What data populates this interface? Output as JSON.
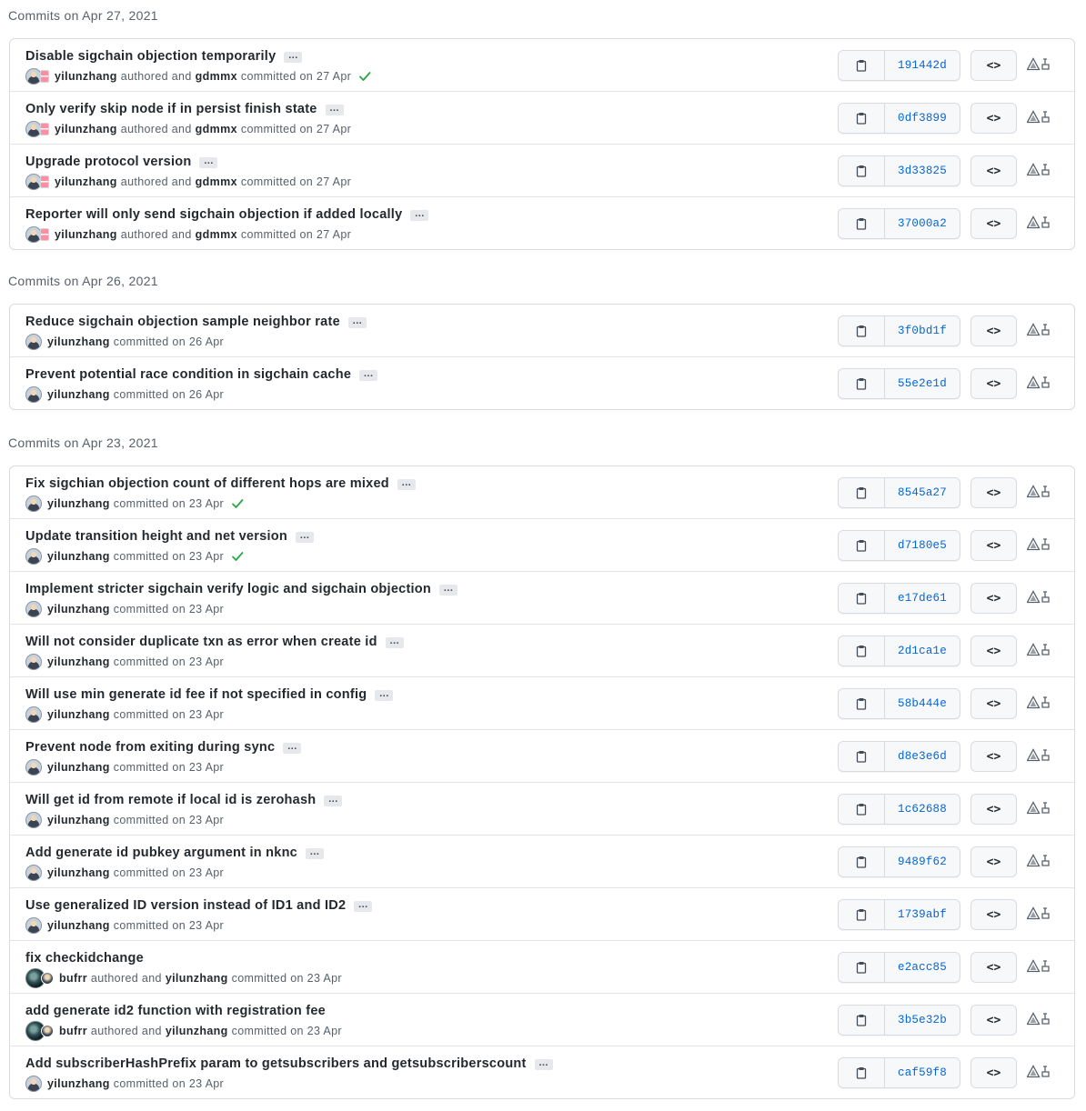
{
  "groups": [
    {
      "header": "Commits on Apr 27, 2021",
      "commits": [
        {
          "message": "Disable sigchain objection temporarily",
          "ellipsis": true,
          "avatar": "yi-gd",
          "author": "yilunzhang",
          "mid": "authored and",
          "committer": "gdmmx",
          "suffix": "committed on 27 Apr",
          "verified": true,
          "sha": "191442d"
        },
        {
          "message": "Only verify skip node if in persist finish state",
          "ellipsis": true,
          "avatar": "yi-gd",
          "author": "yilunzhang",
          "mid": "authored and",
          "committer": "gdmmx",
          "suffix": "committed on 27 Apr",
          "verified": false,
          "sha": "0df3899"
        },
        {
          "message": "Upgrade protocol version",
          "ellipsis": true,
          "avatar": "yi-gd",
          "author": "yilunzhang",
          "mid": "authored and",
          "committer": "gdmmx",
          "suffix": "committed on 27 Apr",
          "verified": false,
          "sha": "3d33825"
        },
        {
          "message": "Reporter will only send sigchain objection if added locally",
          "ellipsis": true,
          "avatar": "yi-gd",
          "author": "yilunzhang",
          "mid": "authored and",
          "committer": "gdmmx",
          "suffix": "committed on 27 Apr",
          "verified": false,
          "sha": "37000a2"
        }
      ]
    },
    {
      "header": "Commits on Apr 26, 2021",
      "commits": [
        {
          "message": "Reduce sigchain objection sample neighbor rate",
          "ellipsis": true,
          "avatar": "yi",
          "author": "yilunzhang",
          "mid": "",
          "committer": "",
          "suffix": "committed on 26 Apr",
          "verified": false,
          "sha": "3f0bd1f"
        },
        {
          "message": "Prevent potential race condition in sigchain cache",
          "ellipsis": true,
          "avatar": "yi",
          "author": "yilunzhang",
          "mid": "",
          "committer": "",
          "suffix": "committed on 26 Apr",
          "verified": false,
          "sha": "55e2e1d"
        }
      ]
    },
    {
      "header": "Commits on Apr 23, 2021",
      "commits": [
        {
          "message": "Fix sigchian objection count of different hops are mixed",
          "ellipsis": true,
          "avatar": "yi",
          "author": "yilunzhang",
          "mid": "",
          "committer": "",
          "suffix": "committed on 23 Apr",
          "verified": true,
          "sha": "8545a27"
        },
        {
          "message": "Update transition height and net version",
          "ellipsis": true,
          "avatar": "yi",
          "author": "yilunzhang",
          "mid": "",
          "committer": "",
          "suffix": "committed on 23 Apr",
          "verified": true,
          "sha": "d7180e5"
        },
        {
          "message": "Implement stricter sigchain verify logic and sigchain objection",
          "ellipsis": true,
          "avatar": "yi",
          "author": "yilunzhang",
          "mid": "",
          "committer": "",
          "suffix": "committed on 23 Apr",
          "verified": false,
          "sha": "e17de61"
        },
        {
          "message": "Will not consider duplicate txn as error when create id",
          "ellipsis": true,
          "avatar": "yi",
          "author": "yilunzhang",
          "mid": "",
          "committer": "",
          "suffix": "committed on 23 Apr",
          "verified": false,
          "sha": "2d1ca1e"
        },
        {
          "message": "Will use min generate id fee if not specified in config",
          "ellipsis": true,
          "avatar": "yi",
          "author": "yilunzhang",
          "mid": "",
          "committer": "",
          "suffix": "committed on 23 Apr",
          "verified": false,
          "sha": "58b444e"
        },
        {
          "message": "Prevent node from exiting during sync",
          "ellipsis": true,
          "avatar": "yi",
          "author": "yilunzhang",
          "mid": "",
          "committer": "",
          "suffix": "committed on 23 Apr",
          "verified": false,
          "sha": "d8e3e6d"
        },
        {
          "message": "Will get id from remote if local id is zerohash",
          "ellipsis": true,
          "avatar": "yi",
          "author": "yilunzhang",
          "mid": "",
          "committer": "",
          "suffix": "committed on 23 Apr",
          "verified": false,
          "sha": "1c62688"
        },
        {
          "message": "Add generate id pubkey argument in nknc",
          "ellipsis": true,
          "avatar": "yi",
          "author": "yilunzhang",
          "mid": "",
          "committer": "",
          "suffix": "committed on 23 Apr",
          "verified": false,
          "sha": "9489f62"
        },
        {
          "message": "Use generalized ID version instead of ID1 and ID2",
          "ellipsis": true,
          "avatar": "yi",
          "author": "yilunzhang",
          "mid": "",
          "committer": "",
          "suffix": "committed on 23 Apr",
          "verified": false,
          "sha": "1739abf"
        },
        {
          "message": "fix checkidchange",
          "ellipsis": false,
          "avatar": "bu-yi",
          "author": "bufrr",
          "mid": "authored and",
          "committer": "yilunzhang",
          "suffix": "committed on 23 Apr",
          "verified": false,
          "sha": "e2acc85"
        },
        {
          "message": "add generate id2 function with registration fee",
          "ellipsis": false,
          "avatar": "bu-yi",
          "author": "bufrr",
          "mid": "authored and",
          "committer": "yilunzhang",
          "suffix": "committed on 23 Apr",
          "verified": false,
          "sha": "3b5e32b"
        },
        {
          "message": "Add subscriberHashPrefix param to getsubscribers and getsubscriberscount",
          "ellipsis": true,
          "avatar": "yi",
          "author": "yilunzhang",
          "mid": "",
          "committer": "",
          "suffix": "committed on 23 Apr",
          "verified": false,
          "sha": "caf59f8"
        }
      ]
    }
  ],
  "browse_label": "<>",
  "icons": {
    "copy": "clipboard-icon",
    "browse": "code-icon",
    "verified": "check-icon",
    "ext": "extension-icon"
  },
  "colors": {
    "sha": "#0366d6",
    "verified": "#28a745"
  }
}
